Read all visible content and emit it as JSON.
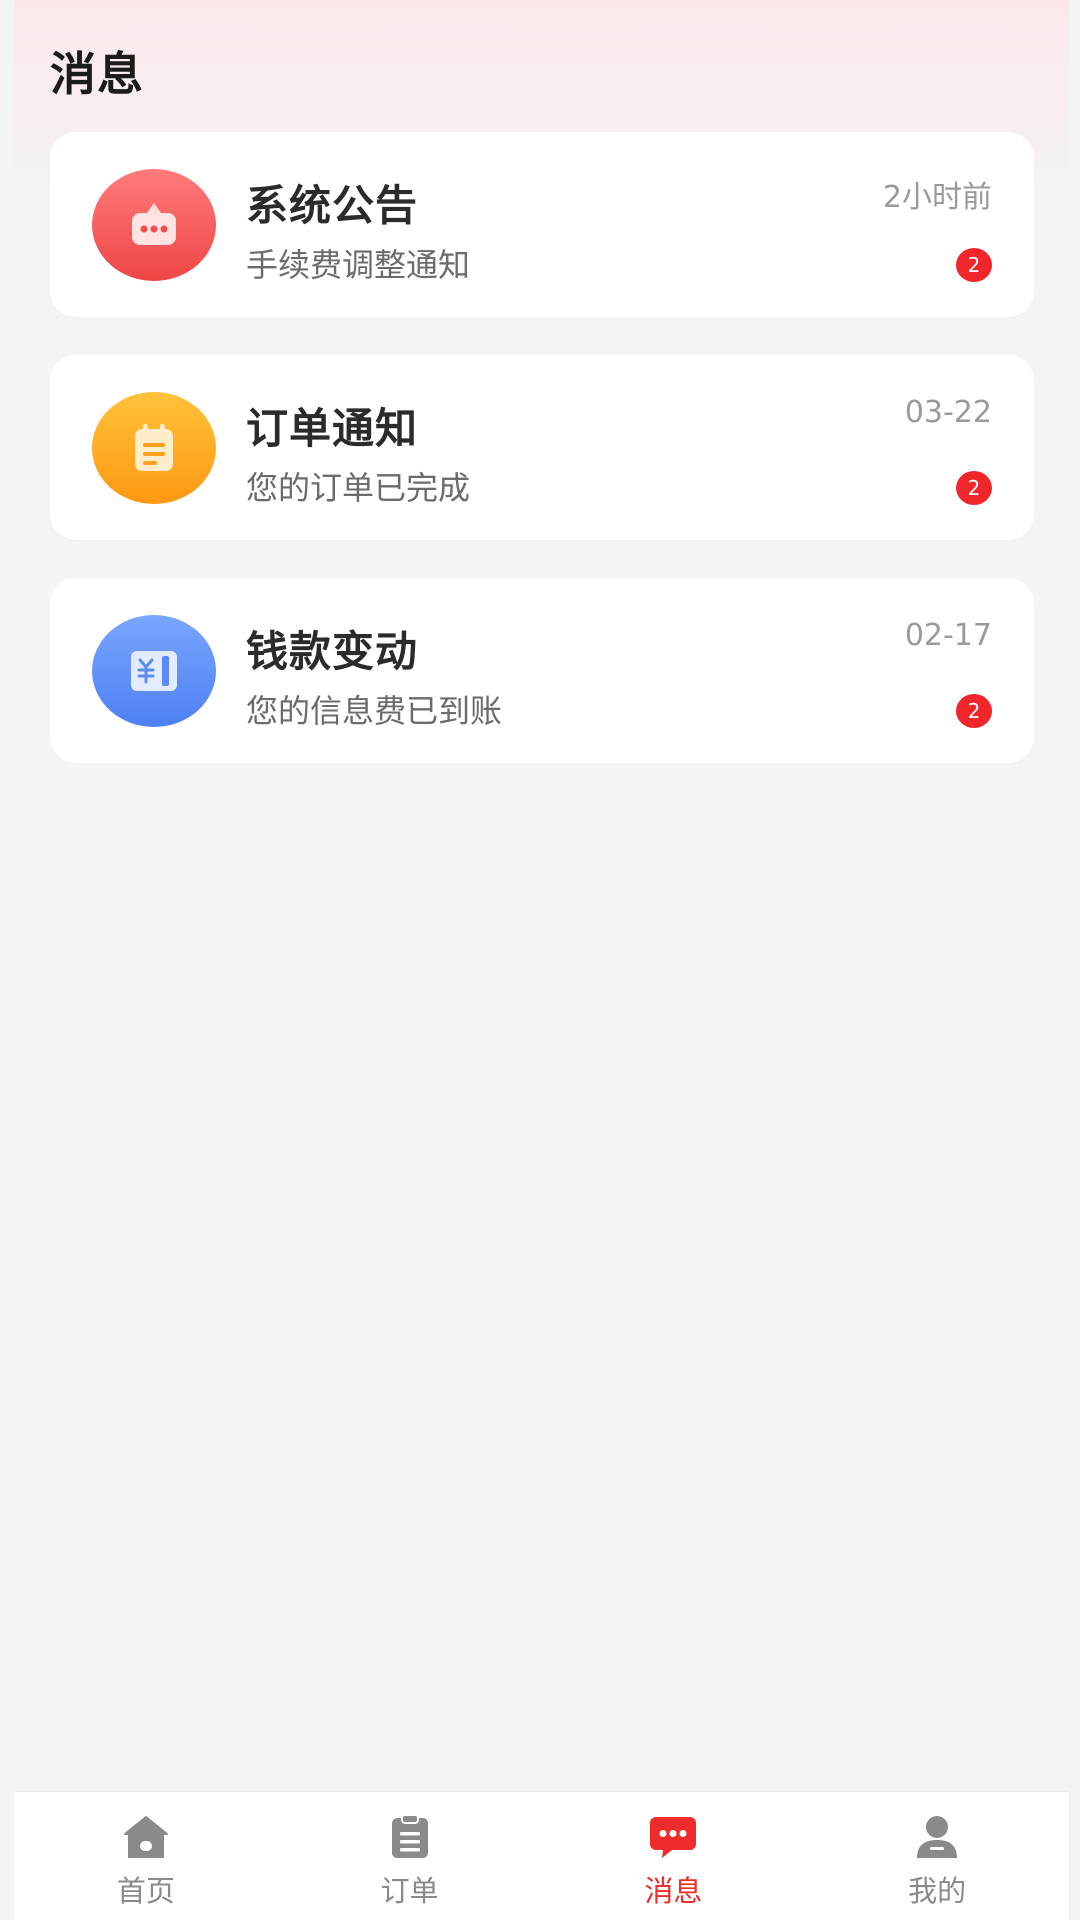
{
  "header": {
    "title": "消息"
  },
  "messages": [
    {
      "title": "系统公告",
      "subtitle": "手续费调整通知",
      "time": "2小时前",
      "badge": "2",
      "icon": "announcement-icon",
      "color": "#f25050"
    },
    {
      "title": "订单通知",
      "subtitle": "您的订单已完成",
      "time": "03-22",
      "badge": "2",
      "icon": "clipboard-icon",
      "color": "#ffa11f"
    },
    {
      "title": "钱款变动",
      "subtitle": "您的信息费已到账",
      "time": "02-17",
      "badge": "2",
      "icon": "wallet-icon",
      "color": "#5b8cf6"
    }
  ],
  "tabbar": {
    "tabs": [
      {
        "label": "首页",
        "icon": "home-icon",
        "active": false
      },
      {
        "label": "订单",
        "icon": "order-clipboard-icon",
        "active": false
      },
      {
        "label": "消息",
        "icon": "chat-icon",
        "active": true
      },
      {
        "label": "我的",
        "icon": "user-icon",
        "active": false
      }
    ]
  },
  "colors": {
    "accent": "#ef2b2b",
    "badge": "#f0262a",
    "background": "#f3f4f6",
    "inactive_tab": "#8a8a8a"
  }
}
